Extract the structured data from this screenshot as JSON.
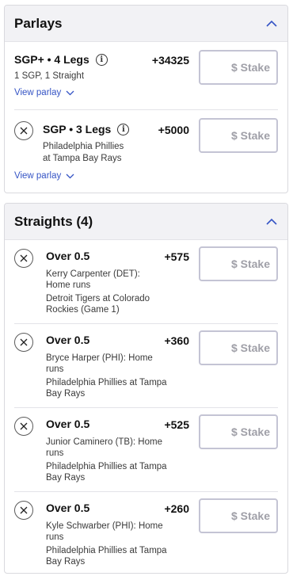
{
  "parlays": {
    "title": "Parlays",
    "items": [
      {
        "title": "SGP+ • 4 Legs",
        "odds": "+34325",
        "detail": "1 SGP, 1 Straight",
        "link": "View parlay",
        "stake_placeholder": "$ Stake"
      },
      {
        "title": "SGP • 3 Legs",
        "odds": "+5000",
        "detail_line1": "Philadelphia Phillies",
        "detail_line2": "at Tampa Bay Rays",
        "link": "View parlay",
        "stake_placeholder": "$ Stake"
      }
    ]
  },
  "straights": {
    "title": "Straights (4)",
    "items": [
      {
        "title": "Over 0.5",
        "odds": "+575",
        "player_line1": "Kerry Carpenter (DET):",
        "player_line2": "Home runs",
        "game_line1": "Detroit Tigers at Colorado",
        "game_line2": "Rockies (Game 1)",
        "stake_placeholder": "$ Stake"
      },
      {
        "title": "Over 0.5",
        "odds": "+360",
        "player_line1": "Bryce Harper (PHI): Home",
        "player_line2": "runs",
        "game_line1": "Philadelphia Phillies at Tampa",
        "game_line2": "Bay Rays",
        "stake_placeholder": "$ Stake"
      },
      {
        "title": "Over 0.5",
        "odds": "+525",
        "player_line1": "Junior Caminero (TB): Home",
        "player_line2": "runs",
        "game_line1": "Philadelphia Phillies at Tampa",
        "game_line2": "Bay Rays",
        "stake_placeholder": "$ Stake"
      },
      {
        "title": "Over 0.5",
        "odds": "+260",
        "player_line1": "Kyle Schwarber (PHI): Home",
        "player_line2": "runs",
        "game_line1": "Philadelphia Phillies at Tampa",
        "game_line2": "Bay Rays",
        "stake_placeholder": "$ Stake"
      }
    ]
  },
  "icons": {
    "collapse": "chevron-up-icon",
    "remove": "close-icon",
    "info": "info-icon",
    "expand": "chevron-down-icon"
  },
  "colors": {
    "link": "#3554c5",
    "header_bg": "#f2f2f5",
    "stake_border": "#c4c4d4",
    "chevron": "#3554c5"
  }
}
